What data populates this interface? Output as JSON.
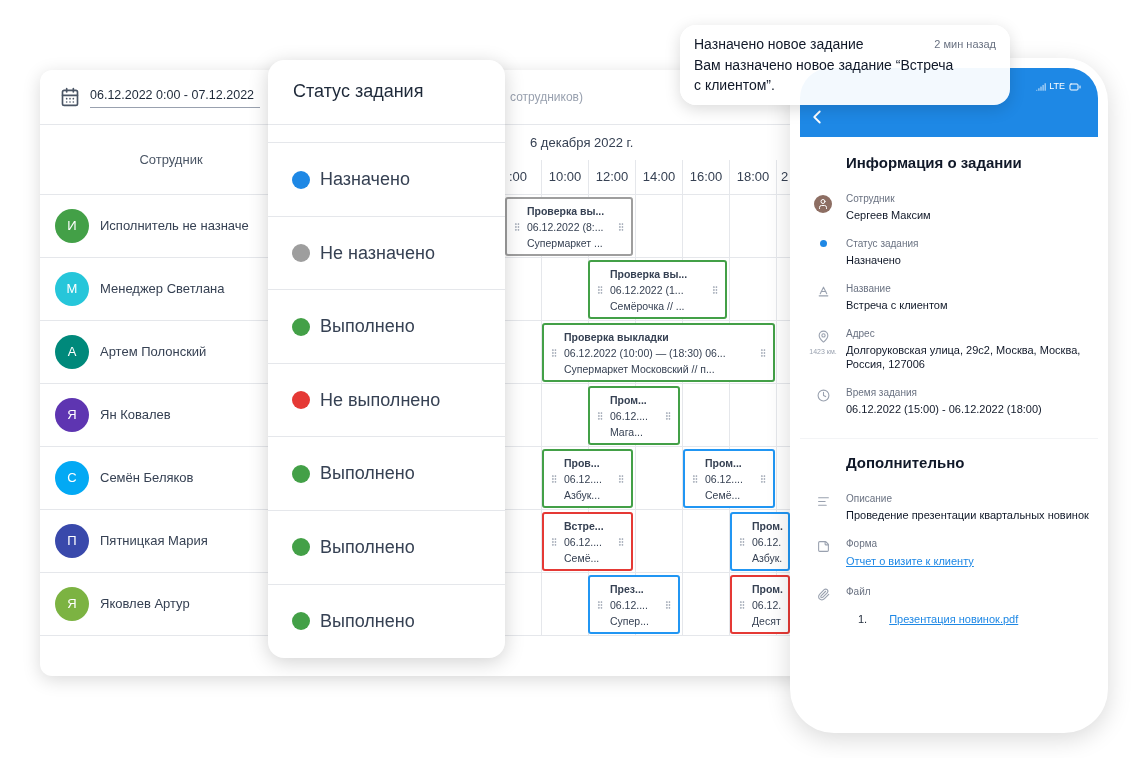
{
  "scheduler": {
    "date_range": "06.12.2022 0:00 - 07.12.2022",
    "filter_hint": "сотрудников)",
    "employee_column": "Сотрудник",
    "day": "6 декабря 2022 г.",
    "hours": [
      ":00",
      "10:00",
      "12:00",
      "14:00",
      "16:00",
      "18:00",
      "2"
    ],
    "rows": [
      {
        "initial": "И",
        "name": "Исполнитель не назначе",
        "color": "#43a047",
        "tasks": [
          {
            "title": "Проверка вы...",
            "time": "06.12.2022 (8:...",
            "place": "Супермаркет ...",
            "color": "#9e9e9e"
          }
        ]
      },
      {
        "initial": "М",
        "name": "Менеджер Светлана",
        "color": "#26c6da",
        "tasks": [
          {
            "title": "Проверка вы...",
            "time": "06.12.2022 (1...",
            "place": "Семёрочка // ...",
            "color": "#43a047"
          }
        ]
      },
      {
        "initial": "А",
        "name": "Артем Полонский",
        "color": "#00897b",
        "tasks": [
          {
            "title": "Проверка выкладки",
            "time": "06.12.2022 (10:00) — (18:30) 06...",
            "place": "Супермаркет Московский // п...",
            "color": "#43a047"
          }
        ]
      },
      {
        "initial": "Я",
        "name": "Ян Ковалев",
        "color": "#5e35b1",
        "tasks": [
          {
            "title": "Пром...",
            "time": "06.12....",
            "place": "Мага...",
            "color": "#43a047"
          }
        ]
      },
      {
        "initial": "С",
        "name": "Семён Беляков",
        "color": "#03a9f4",
        "tasks": [
          {
            "title": "Пров...",
            "time": "06.12....",
            "place": "Азбук...",
            "color": "#43a047"
          },
          {
            "title": "Пром...",
            "time": "06.12....",
            "place": "Семё...",
            "color": "#2196f3"
          }
        ]
      },
      {
        "initial": "П",
        "name": "Пятницкая Мария",
        "color": "#3949ab",
        "tasks": [
          {
            "title": "Встре...",
            "time": "06.12....",
            "place": "Семё...",
            "color": "#e53935"
          },
          {
            "title": "Пром.",
            "time": "06.12.",
            "place": "Азбук.",
            "color": "#2196f3"
          }
        ]
      },
      {
        "initial": "Я",
        "name": "Яковлев Артур",
        "color": "#7cb342",
        "tasks": [
          {
            "title": "През...",
            "time": "06.12....",
            "place": "Супер...",
            "color": "#2196f3"
          },
          {
            "title": "Пром.",
            "time": "06.12.",
            "place": "Десят",
            "color": "#e53935"
          }
        ]
      }
    ]
  },
  "status_panel": {
    "title": "Статус задания",
    "items": [
      {
        "label": "Назначено",
        "color": "#1e88e5"
      },
      {
        "label": "Не назначено",
        "color": "#9e9e9e"
      },
      {
        "label": "Выполнено",
        "color": "#43a047"
      },
      {
        "label": "Не выполнено",
        "color": "#e53935"
      },
      {
        "label": "Выполнено",
        "color": "#43a047"
      },
      {
        "label": "Выполнено",
        "color": "#43a047"
      },
      {
        "label": "Выполнено",
        "color": "#43a047"
      }
    ]
  },
  "notification": {
    "title": "Назначено новое задание",
    "time": "2 мин назад",
    "body": "Вам назначено новое задание “Встреча с клиентом”."
  },
  "phone": {
    "network": "LTE",
    "task_info": {
      "heading": "Информация о задании",
      "fields": [
        {
          "kind": "employee",
          "label": "Сотрудник",
          "value": "Сергеев Максим"
        },
        {
          "kind": "status",
          "label": "Статус задания",
          "value": "Назначено",
          "color": "#1e88e5"
        },
        {
          "kind": "title",
          "label": "Название",
          "value": "Встреча с клиентом"
        },
        {
          "kind": "address",
          "label": "Адрес",
          "value": "Долгоруковская улица, 29с2, Москва, Москва, Россия, 127006",
          "distance": "1423 км."
        },
        {
          "kind": "time",
          "label": "Время задания",
          "value": "06.12.2022 (15:00) - 06.12.2022 (18:00)"
        }
      ]
    },
    "additional": {
      "heading": "Дополнительно",
      "fields": [
        {
          "kind": "description",
          "label": "Описание",
          "value": "Проведение презентации квартальных новинок"
        },
        {
          "kind": "form",
          "label": "Форма",
          "link": "Отчет о визите к клиенту"
        },
        {
          "kind": "file",
          "label": "Файл",
          "files": [
            {
              "number": "1.",
              "name": "Презентация новинок.pdf"
            }
          ]
        }
      ]
    }
  }
}
